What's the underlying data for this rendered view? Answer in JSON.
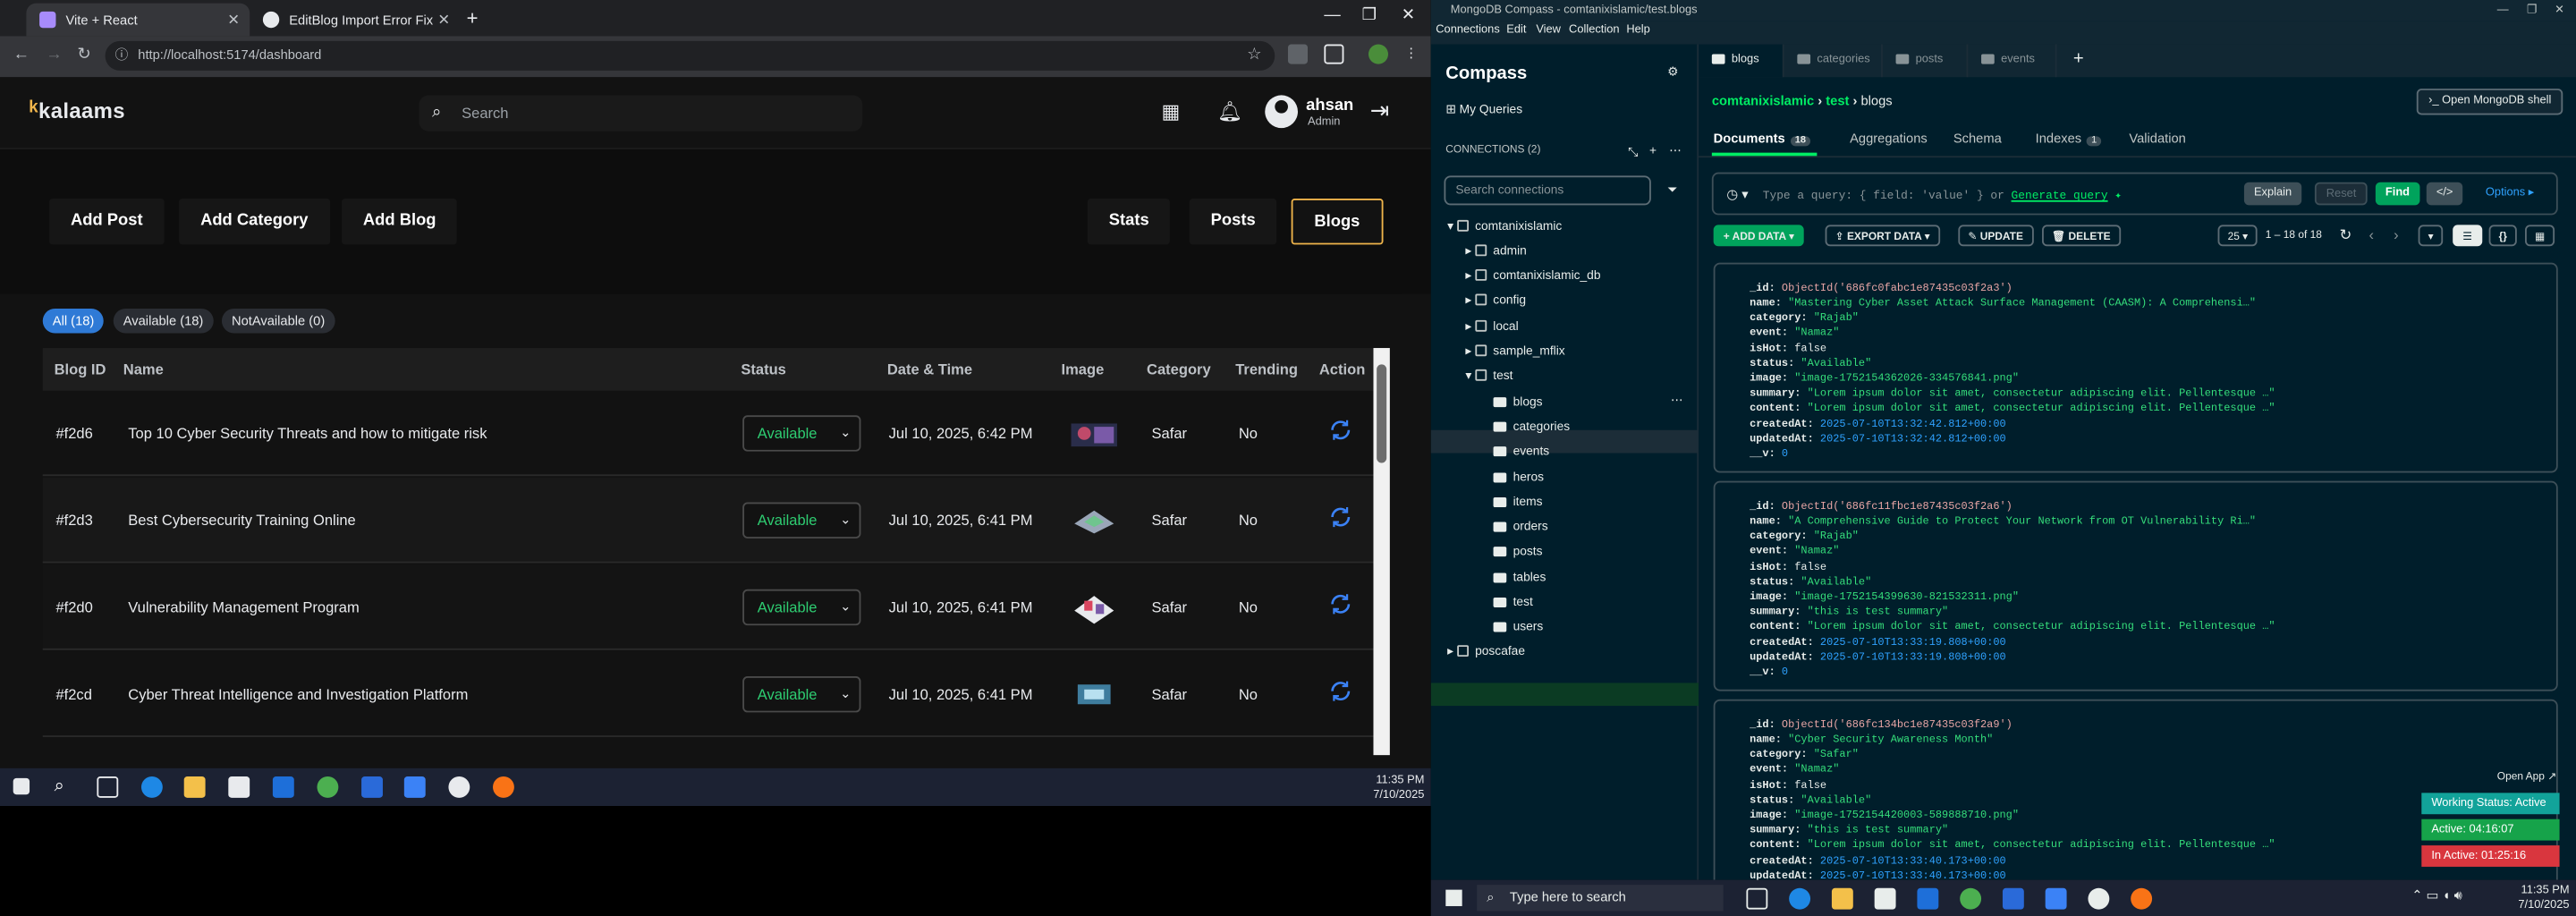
{
  "chrome": {
    "tabs": [
      {
        "title": "Vite + React"
      },
      {
        "title": "EditBlog Import Error Fix"
      }
    ],
    "url": "http://localhost:5174/dashboard"
  },
  "app": {
    "logo_text": "kalaams",
    "search_placeholder": "Search",
    "user_name": "ahsan",
    "user_role": "Admin",
    "actions": {
      "add_post": "Add Post",
      "add_category": "Add Category",
      "add_blog": "Add Blog",
      "stats": "Stats",
      "posts": "Posts",
      "blogs": "Blogs"
    },
    "filters": {
      "all": "All (18)",
      "available": "Available (18)",
      "not_available": "NotAvailable (0)"
    },
    "columns": {
      "id": "Blog ID",
      "name": "Name",
      "status": "Status",
      "date": "Date & Time",
      "image": "Image",
      "category": "Category",
      "trending": "Trending",
      "action": "Action"
    },
    "rows": [
      {
        "id": "#f2d6",
        "name": "Top 10 Cyber Security Threats and how to mitigate risk",
        "status": "Available",
        "date": "Jul 10, 2025, 6:42 PM",
        "category": "Safar",
        "trending": "No"
      },
      {
        "id": "#f2d3",
        "name": "Best Cybersecurity Training Online",
        "status": "Available",
        "date": "Jul 10, 2025, 6:41 PM",
        "category": "Safar",
        "trending": "No"
      },
      {
        "id": "#f2d0",
        "name": "Vulnerability Management Program",
        "status": "Available",
        "date": "Jul 10, 2025, 6:41 PM",
        "category": "Safar",
        "trending": "No"
      },
      {
        "id": "#f2cd",
        "name": "Cyber Threat Intelligence and Investigation Platform",
        "status": "Available",
        "date": "Jul 10, 2025, 6:41 PM",
        "category": "Safar",
        "trending": "No"
      }
    ]
  },
  "taskbar_left": {
    "time": "11:35 PM",
    "date": "7/10/2025"
  },
  "compass": {
    "title": "MongoDB Compass - comtanixislamic/test.blogs",
    "menu": [
      "Connections",
      "Edit",
      "View",
      "Collection",
      "Help"
    ],
    "brand": "Compass",
    "my_queries": "My Queries",
    "connections_label": "CONNECTIONS (2)",
    "search_placeholder": "Search connections",
    "tree": {
      "root": "comtanixislamic",
      "dbs": [
        "admin",
        "comtanixislamic_db",
        "config",
        "local",
        "sample_mflix",
        "test"
      ],
      "collections": [
        "blogs",
        "categories",
        "events",
        "heros",
        "items",
        "orders",
        "posts",
        "tables",
        "test",
        "users"
      ],
      "other_conn": "poscafae"
    },
    "tabs": [
      "blogs",
      "categories",
      "posts",
      "events"
    ],
    "breadcrumb": {
      "conn": "comtanixislamic",
      "db": "test",
      "coll": "blogs"
    },
    "open_shell": "Open MongoDB shell",
    "subtabs": {
      "documents": "Documents",
      "documents_count": "18",
      "aggregations": "Aggregations",
      "schema": "Schema",
      "indexes": "Indexes",
      "indexes_count": "1",
      "validation": "Validation"
    },
    "query_placeholder": "Type a query: { field: 'value' } or",
    "generate_query": "Generate query",
    "buttons": {
      "explain": "Explain",
      "reset": "Reset",
      "find": "Find",
      "options": "Options"
    },
    "toolbar": {
      "add_data": "ADD DATA",
      "export_data": "EXPORT DATA",
      "update": "UPDATE",
      "delete": "DELETE",
      "page_size": "25",
      "range": "1 – 18 of 18"
    },
    "docs": [
      {
        "_id": "ObjectId('686fc0fabc1e87435c03f2a3')",
        "name": "\"Mastering Cyber Asset Attack Surface Management (CAASM): A Comprehensi…\"",
        "category": "\"Rajab\"",
        "event": "\"Namaz\"",
        "isHot": "false",
        "status": "\"Available\"",
        "image": "\"image-1752154362026-334576841.png\"",
        "summary": "\"Lorem ipsum dolor sit amet, consectetur adipiscing elit. Pellentesque …\"",
        "content": "\"Lorem ipsum dolor sit amet, consectetur adipiscing elit. Pellentesque …\"",
        "createdAt": "2025-07-10T13:32:42.812+00:00",
        "updatedAt": "2025-07-10T13:32:42.812+00:00",
        "__v": "0"
      },
      {
        "_id": "ObjectId('686fc11fbc1e87435c03f2a6')",
        "name": "\"A Comprehensive Guide to Protect Your Network from OT Vulnerability Ri…\"",
        "category": "\"Rajab\"",
        "event": "\"Namaz\"",
        "isHot": "false",
        "status": "\"Available\"",
        "image": "\"image-1752154399630-821532311.png\"",
        "summary": "\"this is test summary\"",
        "content": "\"Lorem ipsum dolor sit amet, consectetur adipiscing elit. Pellentesque …\"",
        "createdAt": "2025-07-10T13:33:19.808+00:00",
        "updatedAt": "2025-07-10T13:33:19.808+00:00",
        "__v": "0"
      },
      {
        "_id": "ObjectId('686fc134bc1e87435c03f2a9')",
        "name": "\"Cyber Security Awareness Month\"",
        "category": "\"Safar\"",
        "event": "\"Namaz\"",
        "isHot": "false",
        "status": "\"Available\"",
        "image": "\"image-1752154420003-589888710.png\"",
        "summary": "\"this is test summary\"",
        "content": "\"Lorem ipsum dolor sit amet, consectetur adipiscing elit. Pellentesque …\"",
        "createdAt": "2025-07-10T13:33:40.173+00:00",
        "updatedAt": "2025-07-10T13:33:40.173+00:00"
      }
    ],
    "overlay": {
      "open_app": "Open App",
      "working_status": "Working Status: Active",
      "active": "Active: 04:16:07",
      "inactive": "In Active: 01:25:16"
    }
  },
  "taskbar_right": {
    "search": "Type here to search",
    "time": "11:35 PM",
    "date": "7/10/2025"
  },
  "colors": {
    "accent": "#f0b54b",
    "available": "#2ecc71",
    "mongo_green": "#00ed64",
    "active_pill": "#2f7ad6"
  }
}
